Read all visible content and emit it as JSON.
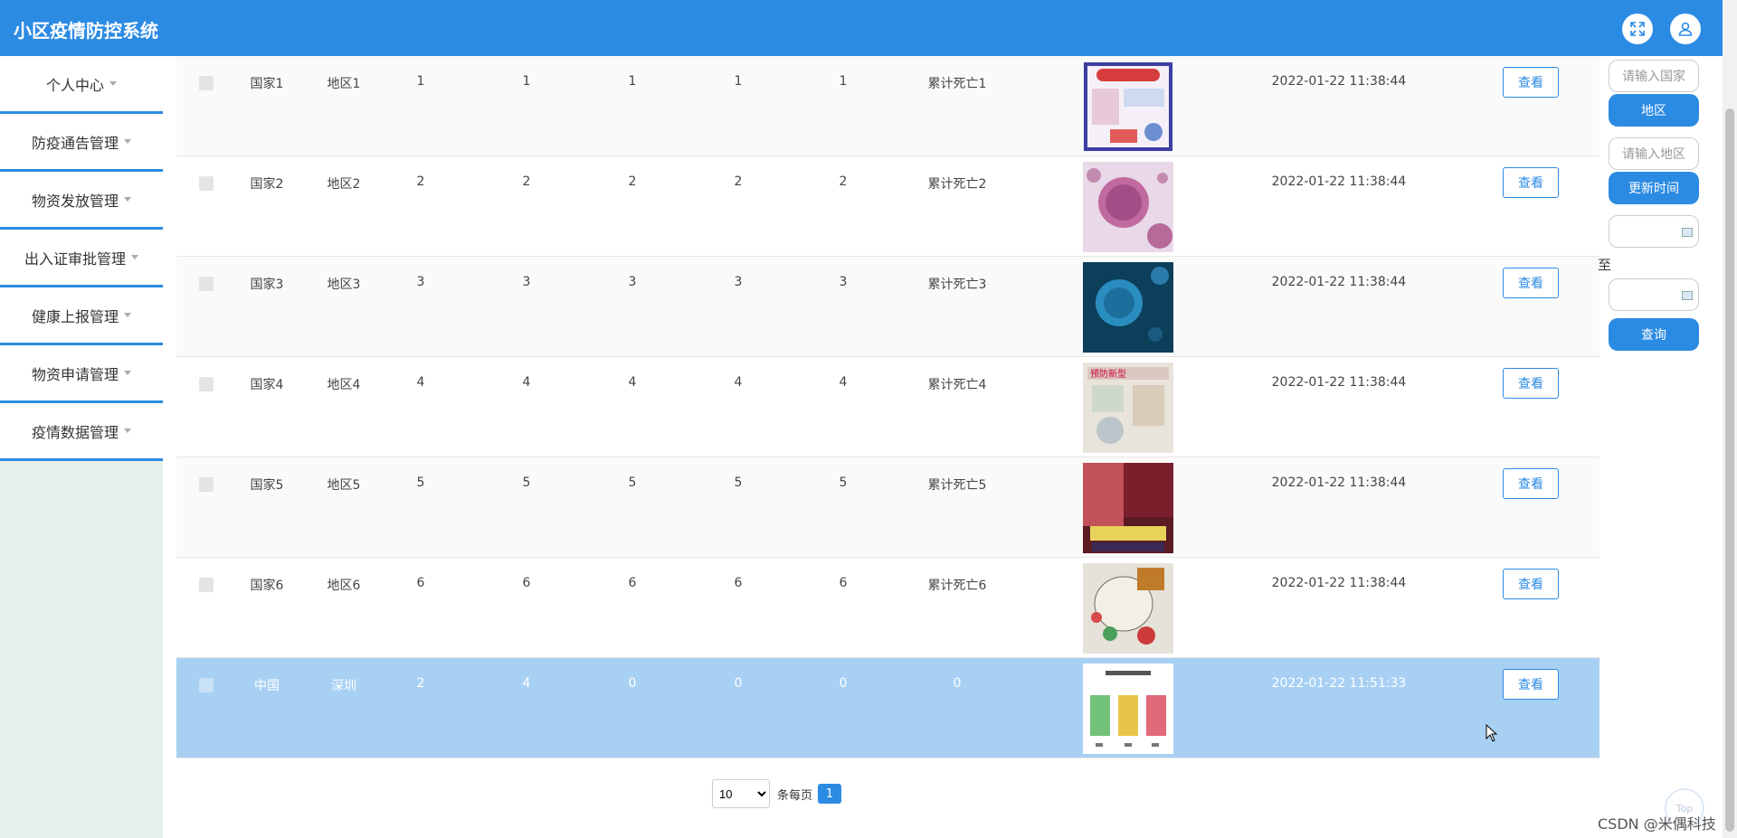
{
  "app": {
    "title": "小区疫情防控系统"
  },
  "header": {
    "fullscreen_icon": "expand-icon",
    "user_icon": "user-icon"
  },
  "sidebar": {
    "items": [
      {
        "label": "个人中心"
      },
      {
        "label": "防疫通告管理"
      },
      {
        "label": "物资发放管理"
      },
      {
        "label": "出入证审批管理"
      },
      {
        "label": "健康上报管理"
      },
      {
        "label": "物资申请管理"
      },
      {
        "label": "疫情数据管理"
      }
    ]
  },
  "table": {
    "view_label": "查看",
    "rows": [
      {
        "country": "国家1",
        "region": "地区1",
        "c1": "1",
        "c2": "1",
        "c3": "1",
        "c4": "1",
        "c5": "1",
        "deaths": "累计死亡1",
        "time": "2022-01-22 11:38:44",
        "image": "poster"
      },
      {
        "country": "国家2",
        "region": "地区2",
        "c1": "2",
        "c2": "2",
        "c3": "2",
        "c4": "2",
        "c5": "2",
        "deaths": "累计死亡2",
        "time": "2022-01-22 11:38:44",
        "image": "virus-pink"
      },
      {
        "country": "国家3",
        "region": "地区3",
        "c1": "3",
        "c2": "3",
        "c3": "3",
        "c4": "3",
        "c5": "3",
        "deaths": "累计死亡3",
        "time": "2022-01-22 11:38:44",
        "image": "virus-blue"
      },
      {
        "country": "国家4",
        "region": "地区4",
        "c1": "4",
        "c2": "4",
        "c3": "4",
        "c4": "4",
        "c5": "4",
        "deaths": "累计死亡4",
        "time": "2022-01-22 11:38:44",
        "image": "poster-sketch"
      },
      {
        "country": "国家5",
        "region": "地区5",
        "c1": "5",
        "c2": "5",
        "c3": "5",
        "c4": "5",
        "c5": "5",
        "deaths": "累计死亡5",
        "time": "2022-01-22 11:38:44",
        "image": "red-banner"
      },
      {
        "country": "国家6",
        "region": "地区6",
        "c1": "6",
        "c2": "6",
        "c3": "6",
        "c4": "6",
        "c5": "6",
        "deaths": "累计死亡6",
        "time": "2022-01-22 11:38:44",
        "image": "drawing"
      },
      {
        "country": "中国",
        "region": "深圳",
        "c1": "2",
        "c2": "4",
        "c3": "0",
        "c4": "0",
        "c5": "0",
        "deaths": "0",
        "time": "2022-01-22 11:51:33",
        "image": "qr-codes"
      }
    ]
  },
  "filters": {
    "country_placeholder": "请输入国家",
    "region_button": "地区",
    "region_placeholder": "请输入地区",
    "update_time_button": "更新时间",
    "to_label": "至",
    "query_button": "查询"
  },
  "pager": {
    "page_size": "10",
    "page_size_options": [
      "10"
    ],
    "per_page_label": "条每页",
    "current_page": "1"
  },
  "watermark": "CSDN @米偶科技",
  "top_button": "Top",
  "colors": {
    "primary": "#2b8be3",
    "selected_row": "#a7d0f3",
    "sidebar_bg": "#e6f0ec"
  }
}
